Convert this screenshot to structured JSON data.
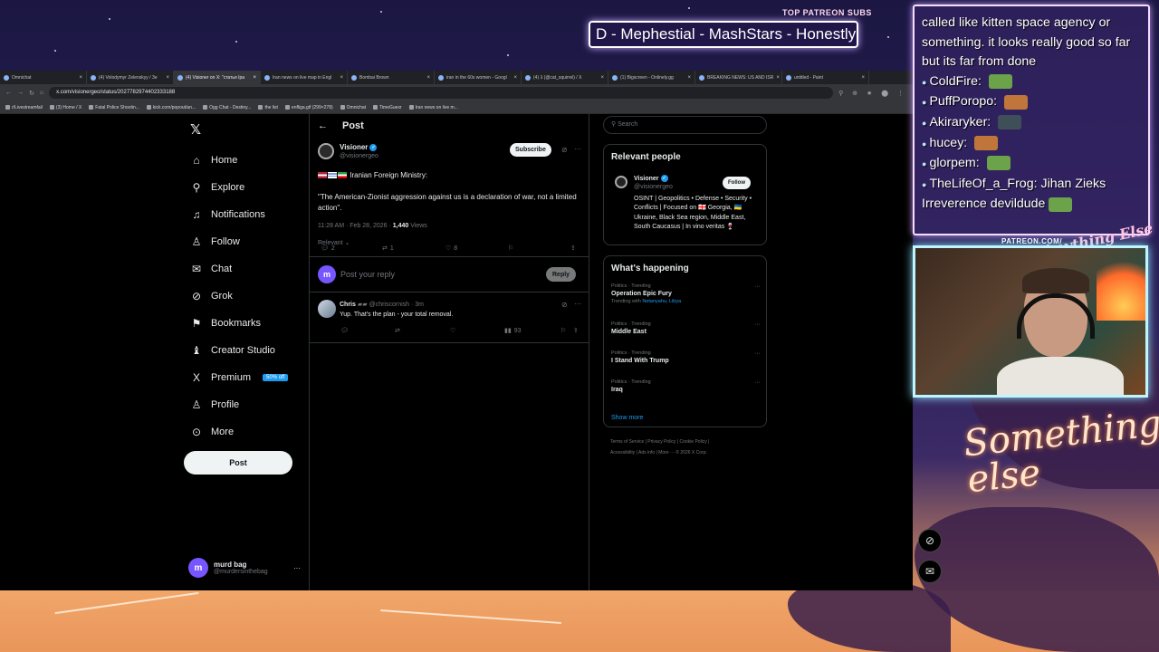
{
  "overlay": {
    "patreon_title": "TOP PATREON SUBS",
    "patreon_names": "D - Mephestial - MashStars - Honestly",
    "patreon_url": "PATREON.COM/",
    "anything_else": "Anything Else",
    "something_else": "Something else"
  },
  "browser": {
    "tabs": [
      {
        "label": "Omnichat"
      },
      {
        "label": "(4) Volodymyr Zelenskyy / Зе"
      },
      {
        "label": "(4) Visioner on X: \"статья Іра"
      },
      {
        "label": "Iran news on live map in Engl"
      },
      {
        "label": "Bombai Brown"
      },
      {
        "label": "iran in the 60s women - Googl"
      },
      {
        "label": "(4) Ꝫ (@cat_squirrel) / X"
      },
      {
        "label": "(1) Bigscreen - Onlinely.gg"
      },
      {
        "label": "BREAKING NEWS: US AND ISR"
      },
      {
        "label": "untitled - Paint"
      }
    ],
    "url": "x.com/visionergeo/status/2027782974402333188",
    "bookmarks": [
      "r/Livestreamfail",
      "(3) Home / X",
      "Fatal Police Shootin...",
      "kick.com/popout/an...",
      "Ogg Chat - Destiny...",
      "the list",
      "enfliga.gif (299×278)",
      "Omnichat",
      "TimeGuesr",
      "Iran news on live m..."
    ]
  },
  "nav": {
    "items": [
      {
        "label": "Home",
        "icon": "⌂"
      },
      {
        "label": "Explore",
        "icon": "⚲"
      },
      {
        "label": "Notifications",
        "icon": "♫"
      },
      {
        "label": "Follow",
        "icon": "♙"
      },
      {
        "label": "Chat",
        "icon": "✉"
      },
      {
        "label": "Grok",
        "icon": "⊘"
      },
      {
        "label": "Bookmarks",
        "icon": "⚑"
      },
      {
        "label": "Creator Studio",
        "icon": "♝"
      },
      {
        "label": "Premium",
        "icon": "X"
      },
      {
        "label": "Profile",
        "icon": "♙"
      },
      {
        "label": "More",
        "icon": "⊙"
      }
    ],
    "premium_badge": "50% off",
    "post_label": "Post",
    "account_name": "murd bag",
    "account_handle": "@murdersinthebag"
  },
  "main": {
    "header_title": "Post",
    "tweet": {
      "name": "Visioner",
      "handle": "@visionergeo",
      "subscribe": "Subscribe",
      "line1": "Iranian Foreign Ministry:",
      "line2": "\"The American-Zionist aggression against us is a declaration of war, not a limited action\".",
      "time": "11:28 AM · Feb 28, 2026 · ",
      "views": "1,440",
      "views_label": " Views",
      "replies": "2",
      "reposts": "1",
      "likes": "8"
    },
    "relevant": "Relevant",
    "reply_placeholder": "Post your reply",
    "reply_button": "Reply",
    "reply": {
      "name": "Chris",
      "handle": "@chriscornish · 3m",
      "text": "Yup. That's the plan - your total removal.",
      "views": "93"
    }
  },
  "right": {
    "search_placeholder": "Search",
    "relevant_title": "Relevant people",
    "person_name": "Visioner",
    "person_handle": "@visionergeo",
    "follow": "Follow",
    "person_bio": "OSINT | Geopolitics • Defense • Security • Conflicts | Focused on 🇬🇪 Georgia, 🇺🇦 Ukraine, Black Sea region, Middle East, South Caucasus | In vino veritas 🍷",
    "happening_title": "What's happening",
    "trends": [
      {
        "context": "Politics · Trending",
        "name": "Operation Epic Fury",
        "with_prefix": "Trending with ",
        "with": "Netanyahu, Libya"
      },
      {
        "context": "Politics · Trending",
        "name": "Middle East"
      },
      {
        "context": "Politics · Trending",
        "name": "I Stand With Trump"
      },
      {
        "context": "Politics · Trending",
        "name": "Iraq"
      }
    ],
    "show_more": "Show more",
    "footer_line1": "Terms of Service  |  Privacy Policy  |  Cookie Policy  |",
    "footer_line2": "Accessibility  |  Ads info  |  More ···  © 2026 X Corp."
  },
  "chat": {
    "lines": [
      {
        "user": "",
        "text": "called like kitten space agency or something. it looks really good so far but its far from done",
        "emote": ""
      },
      {
        "user": "ColdFire:",
        "text": "",
        "emote": "#6ca34a"
      },
      {
        "user": "PuffPoropo:",
        "text": "",
        "emote": "#c0763a"
      },
      {
        "user": "Akiraryker:",
        "text": "",
        "emote": "#3f4f5a"
      },
      {
        "user": "hucey:",
        "text": "",
        "emote": "#c0763a"
      },
      {
        "user": "glorpem:",
        "text": "",
        "emote": "#6ca34a"
      },
      {
        "user": "TheLifeOf_a_Frog:",
        "text": "Jihan Zieks Irreverence devildude",
        "emote": "#6ca34a"
      }
    ]
  }
}
